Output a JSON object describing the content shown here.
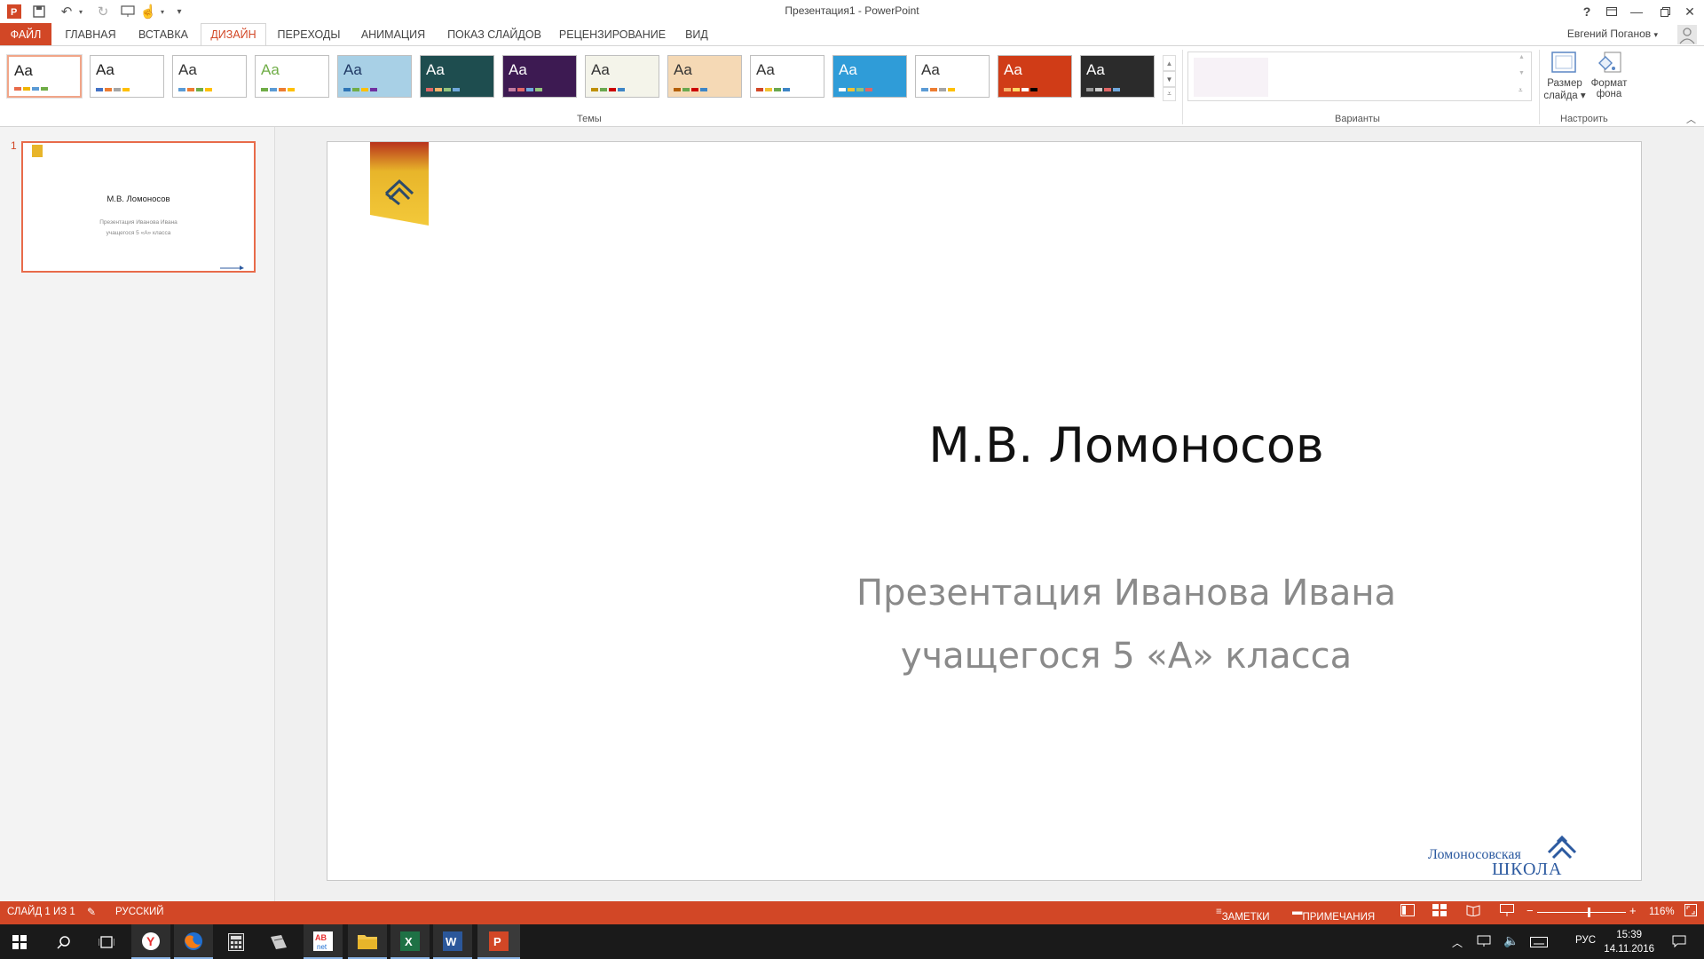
{
  "window": {
    "title": "Презентация1 - PowerPoint",
    "user_name": "Евгений Поганов",
    "help": "?",
    "controls": [
      "ribbon-options",
      "minimize",
      "restore",
      "close"
    ]
  },
  "quick_access": [
    "powerpoint-logo-icon",
    "save-icon",
    "undo-icon",
    "redo-icon",
    "start-slideshow-icon",
    "touch-mode-icon",
    "customize-icon"
  ],
  "tabs": {
    "file": "ФАЙЛ",
    "home": "ГЛАВНАЯ",
    "insert": "ВСТАВКА",
    "design": "ДИЗАЙН",
    "transitions": "ПЕРЕХОДЫ",
    "animation": "АНИМАЦИЯ",
    "slideshow": "ПОКАЗ СЛАЙДОВ",
    "review": "РЕЦЕНЗИРОВАНИЕ",
    "view": "ВИД"
  },
  "ribbon": {
    "themes_label": "Темы",
    "variants_label": "Варианты",
    "customize_label": "Настроить",
    "slide_size_line1": "Размер",
    "slide_size_line2": "слайда",
    "bg_format_line1": "Формат",
    "bg_format_line2": "фона",
    "theme_sample": "Aa",
    "themes": [
      {
        "bg": "#ffffff",
        "fg": "#222222",
        "bars": [
          "#e86b4a",
          "#f0b400",
          "#5b9bd5",
          "#70ad47"
        ]
      },
      {
        "bg": "#ffffff",
        "fg": "#222222",
        "bars": [
          "#4472c4",
          "#ed7d31",
          "#a5a5a5",
          "#ffc000"
        ]
      },
      {
        "bg": "#ffffff",
        "fg": "#333333",
        "bars": [
          "#5b9bd5",
          "#ed7d31",
          "#70ad47",
          "#ffc000"
        ]
      },
      {
        "bg": "#ffffff",
        "fg": "#70ad47",
        "bars": [
          "#70ad47",
          "#5b9bd5",
          "#ed7d31",
          "#ffc000"
        ]
      },
      {
        "bg": "#a8d0e6",
        "fg": "#1f3864",
        "bars": [
          "#2e75b6",
          "#70ad47",
          "#ffc000",
          "#7030a0"
        ]
      },
      {
        "bg": "#1e4d4f",
        "fg": "#ffffff",
        "bars": [
          "#e06666",
          "#f6b26b",
          "#93c47d",
          "#6fa8dc"
        ]
      },
      {
        "bg": "#3d1a52",
        "fg": "#ffffff",
        "bars": [
          "#c27ba0",
          "#e06666",
          "#6fa8dc",
          "#93c47d"
        ]
      },
      {
        "bg": "#f4f4ea",
        "fg": "#333333",
        "bars": [
          "#bf9000",
          "#6aa84f",
          "#cc0000",
          "#3d85c6"
        ]
      },
      {
        "bg": "#f5d9b5",
        "fg": "#333333",
        "bars": [
          "#b45f06",
          "#6aa84f",
          "#cc0000",
          "#3d85c6"
        ]
      },
      {
        "bg": "#ffffff",
        "fg": "#333333",
        "bars": [
          "#d24726",
          "#f1c232",
          "#6aa84f",
          "#3d85c6"
        ]
      },
      {
        "bg": "#2f9cd8",
        "fg": "#ffffff",
        "bars": [
          "#ffffff",
          "#f1c232",
          "#93c47d",
          "#e06666"
        ]
      },
      {
        "bg": "#ffffff",
        "fg": "#333333",
        "bars": [
          "#5b9bd5",
          "#ed7d31",
          "#a5a5a5",
          "#ffc000"
        ]
      },
      {
        "bg": "#d03c17",
        "fg": "#ffffff",
        "bars": [
          "#f6b26b",
          "#ffd966",
          "#ffffff",
          "#000000"
        ]
      },
      {
        "bg": "#2b2b2b",
        "fg": "#ffffff",
        "bars": [
          "#999999",
          "#cccccc",
          "#e06666",
          "#6fa8dc"
        ]
      }
    ]
  },
  "slides_panel": {
    "slide_number": "1",
    "thumb_title": "М.В. Ломоносов",
    "thumb_sub1": "Презентация Иванова Ивана",
    "thumb_sub2": "учащегося 5 «А» класса"
  },
  "slide": {
    "title": "М.В. Ломоносов",
    "subtitle_line1": "Презентация Иванова Ивана",
    "subtitle_line2": "учащегося 5 «А» класса",
    "logo_line1": "Ломоносовская",
    "logo_line2": "ШКОЛА",
    "accent": "#e8b52a",
    "logo_color": "#2c5aa0"
  },
  "status": {
    "slide_info": "СЛАЙД 1 ИЗ 1",
    "language": "РУССКИЙ",
    "notes": "ЗАМЕТКИ",
    "comments": "ПРИМЕЧАНИЯ",
    "zoom": "116%",
    "zoom_fraction": 0.58,
    "color": "#d24726"
  },
  "taskbar": {
    "lang": "РУС",
    "time": "15:39",
    "date": "14.11.2016",
    "apps": [
      "windows-start-icon",
      "search-icon",
      "task-view-icon",
      "yandex-browser-icon",
      "firefox-icon",
      "calculator-icon",
      "app-icon",
      "abbyy-icon",
      "file-explorer-icon",
      "excel-icon",
      "word-icon",
      "powerpoint-icon"
    ]
  }
}
